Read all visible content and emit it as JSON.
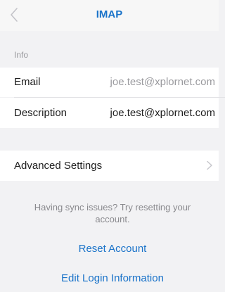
{
  "nav": {
    "title": "IMAP",
    "back_icon": "chevron-left-icon"
  },
  "info_section": {
    "label": "Info",
    "rows": [
      {
        "label": "Email",
        "value": "joe.test@xplornet.com",
        "value_color": "#9a9a9e"
      },
      {
        "label": "Description",
        "value": "joe.test@xplornet.com",
        "value_color": "#1e1e1e"
      }
    ]
  },
  "advanced": {
    "label": "Advanced Settings",
    "chevron_icon": "chevron-right-icon"
  },
  "sync": {
    "hint": "Having sync issues? Try resetting your account.",
    "reset_label": "Reset Account",
    "edit_login_label": "Edit Login Information"
  },
  "colors": {
    "accent": "#1a73c9",
    "background": "#f2f2f4",
    "secondary_text": "#9a9a9e"
  }
}
